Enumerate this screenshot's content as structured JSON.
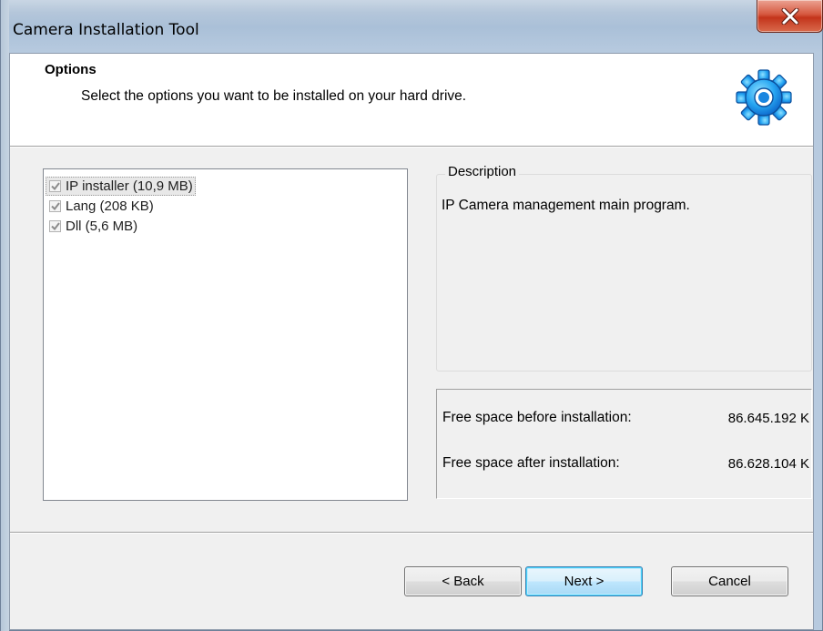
{
  "window": {
    "title": "Camera Installation Tool",
    "close_label": "X"
  },
  "header": {
    "title": "Options",
    "subtitle": "Select the options you want to be installed on your hard drive.",
    "icon": "gear-icon"
  },
  "options": [
    {
      "label": "IP installer (10,9 MB)",
      "checked": true,
      "selected": true
    },
    {
      "label": "Lang (208 KB)",
      "checked": true,
      "selected": false
    },
    {
      "label": "Dll (5,6 MB)",
      "checked": true,
      "selected": false
    }
  ],
  "description": {
    "legend": "Description",
    "text": "IP Camera management main program."
  },
  "space": {
    "before_label": "Free space before installation:",
    "before_value": "86.645.192 K",
    "after_label": "Free space after installation:",
    "after_value": "86.628.104 K"
  },
  "buttons": {
    "back": "< Back",
    "next": "Next >",
    "cancel": "Cancel"
  },
  "colors": {
    "accent": "#1e90ff",
    "close": "#c7371c"
  }
}
